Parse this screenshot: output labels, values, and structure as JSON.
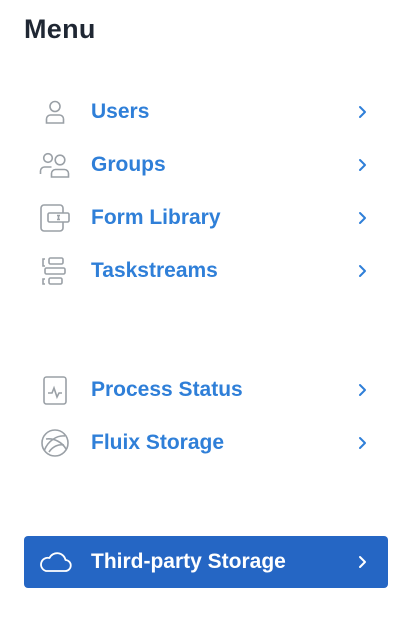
{
  "menu": {
    "title": "Menu",
    "items": [
      {
        "label": "Users",
        "icon": "user-icon"
      },
      {
        "label": "Groups",
        "icon": "group-icon"
      },
      {
        "label": "Form Library",
        "icon": "form-icon"
      },
      {
        "label": "Taskstreams",
        "icon": "taskstream-icon"
      },
      {
        "label": "Process Status",
        "icon": "process-status-icon"
      },
      {
        "label": "Fluix Storage",
        "icon": "fluix-storage-icon"
      },
      {
        "label": "Third-party Storage",
        "icon": "cloud-icon",
        "active": true
      }
    ]
  },
  "colors": {
    "title": "#1f2733",
    "label": "#2f7fd8",
    "icon": "#9aa0a6",
    "active_background": "#2566c4",
    "active_text": "#ffffff"
  }
}
